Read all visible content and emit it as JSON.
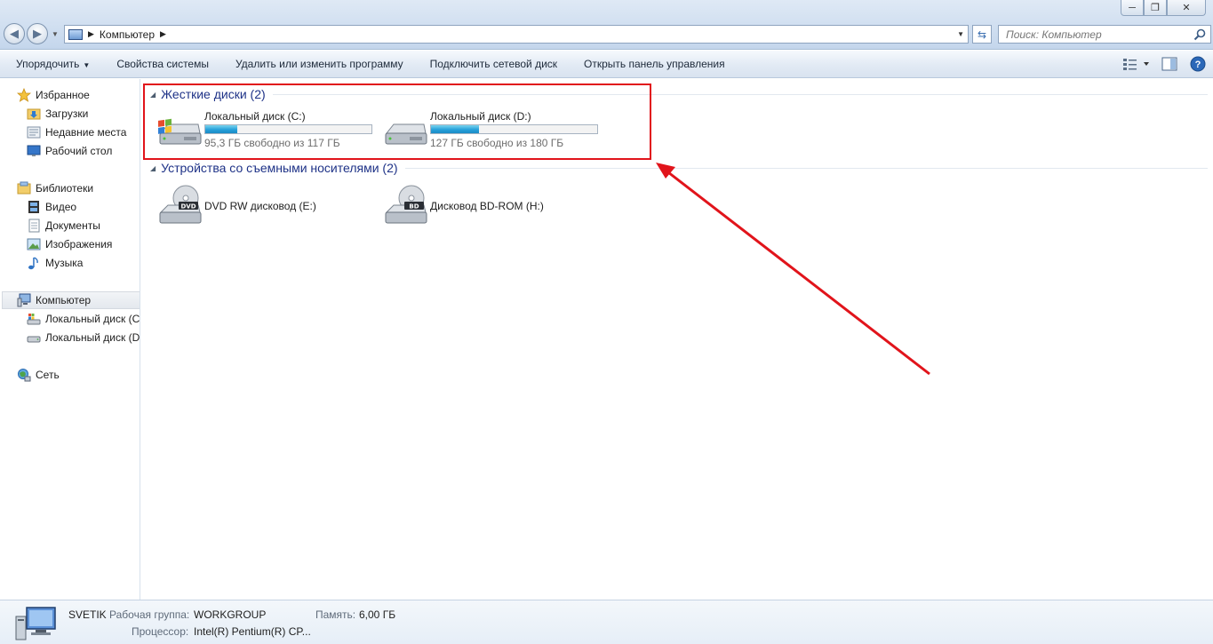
{
  "address": {
    "path": "Компьютер"
  },
  "search": {
    "placeholder": "Поиск: Компьютер"
  },
  "window_controls": {
    "minimize": "─",
    "maximize": "❐",
    "close": "✕"
  },
  "commands": {
    "organize": "Упорядочить",
    "system_properties": "Свойства системы",
    "uninstall": "Удалить или изменить программу",
    "map_drive": "Подключить сетевой диск",
    "control_panel": "Открыть панель управления"
  },
  "sidebar": {
    "favorites": "Избранное",
    "downloads": "Загрузки",
    "recent": "Недавние места",
    "desktop": "Рабочий стол",
    "libraries": "Библиотеки",
    "video": "Видео",
    "documents": "Документы",
    "images": "Изображения",
    "music": "Музыка",
    "computer": "Компьютер",
    "disk_c": "Локальный диск (C",
    "disk_d": "Локальный диск (D",
    "network": "Сеть"
  },
  "groups": {
    "hdd": {
      "title": "Жесткие диски (2)",
      "drives": [
        {
          "name": "Локальный диск (C:)",
          "free": "95,3 ГБ свободно из 117 ГБ",
          "used_fraction": 0.19
        },
        {
          "name": "Локальный диск (D:)",
          "free": "127 ГБ свободно из 180 ГБ",
          "used_fraction": 0.29
        }
      ]
    },
    "removable": {
      "title": "Устройства со съемными носителями (2)",
      "drives": [
        {
          "name": "DVD RW дисковод (E:)",
          "badge": "DVD"
        },
        {
          "name": "Дисковод BD-ROM (H:)",
          "badge": "BD"
        }
      ]
    }
  },
  "details": {
    "computer_name": "SVETIK",
    "workgroup_label": "Рабочая группа:",
    "workgroup_value": "WORKGROUP",
    "memory_label": "Память:",
    "memory_value": "6,00 ГБ",
    "cpu_label": "Процессор:",
    "cpu_value": "Intel(R) Pentium(R) CP..."
  },
  "colors": {
    "annotation": "#e1141b",
    "group_title": "#1e3287",
    "bar_fill": "#26a0da"
  }
}
